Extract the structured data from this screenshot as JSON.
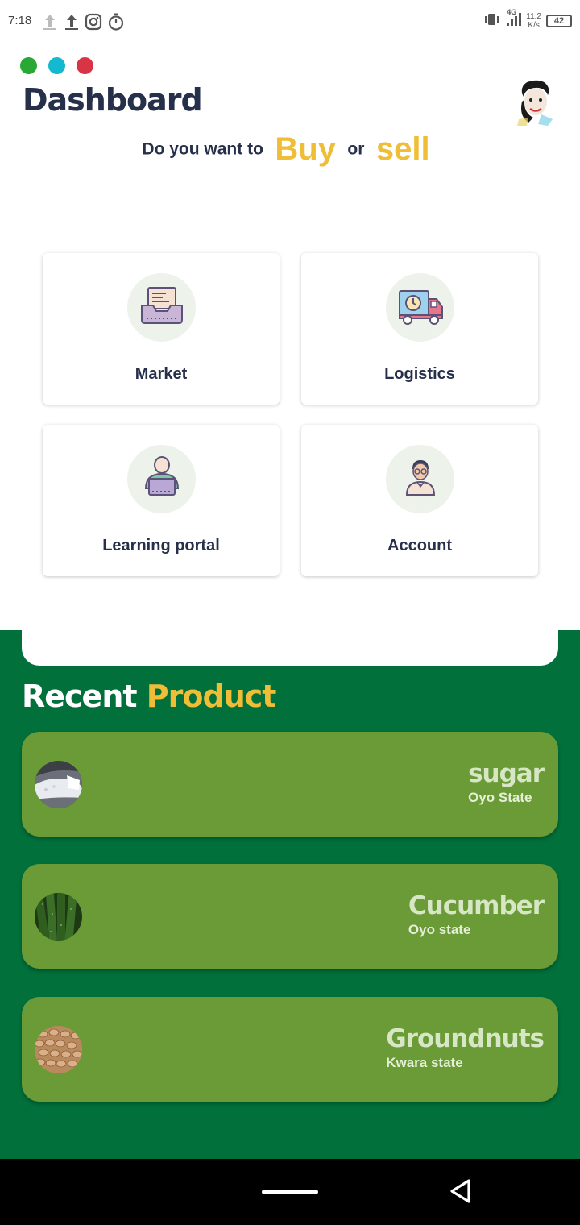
{
  "status_bar": {
    "time": "7:18",
    "network": "4G",
    "speed_value": "11.2",
    "speed_unit": "K/s",
    "battery": "42"
  },
  "header": {
    "title": "Dashboard",
    "dot_colors": [
      "#2aa836",
      "#14b8cf",
      "#d93346"
    ],
    "tagline_prefix": "Do you want to",
    "tagline_buy": "Buy",
    "tagline_or": "or",
    "tagline_sell": "sell"
  },
  "grid": {
    "items": [
      {
        "label": "Market",
        "icon": "market-tray-icon"
      },
      {
        "label": "Logistics",
        "icon": "delivery-truck-icon"
      },
      {
        "label": "Learning portal",
        "icon": "learner-laptop-icon"
      },
      {
        "label": "Account",
        "icon": "user-account-icon"
      }
    ]
  },
  "recent": {
    "title_part1": "Recent",
    "title_part2": "Product",
    "products": [
      {
        "name": "sugar",
        "state": "Oyo State",
        "thumb": "sugar-image"
      },
      {
        "name": "Cucumber",
        "state": "Oyo state",
        "thumb": "cucumber-image"
      },
      {
        "name": "Groundnuts",
        "state": "Kwara state",
        "thumb": "groundnuts-image"
      }
    ]
  },
  "colors": {
    "accent_yellow": "#f0be36",
    "dark_green": "#01703b",
    "card_green": "#6a9b36",
    "text_dark": "#27304a"
  }
}
